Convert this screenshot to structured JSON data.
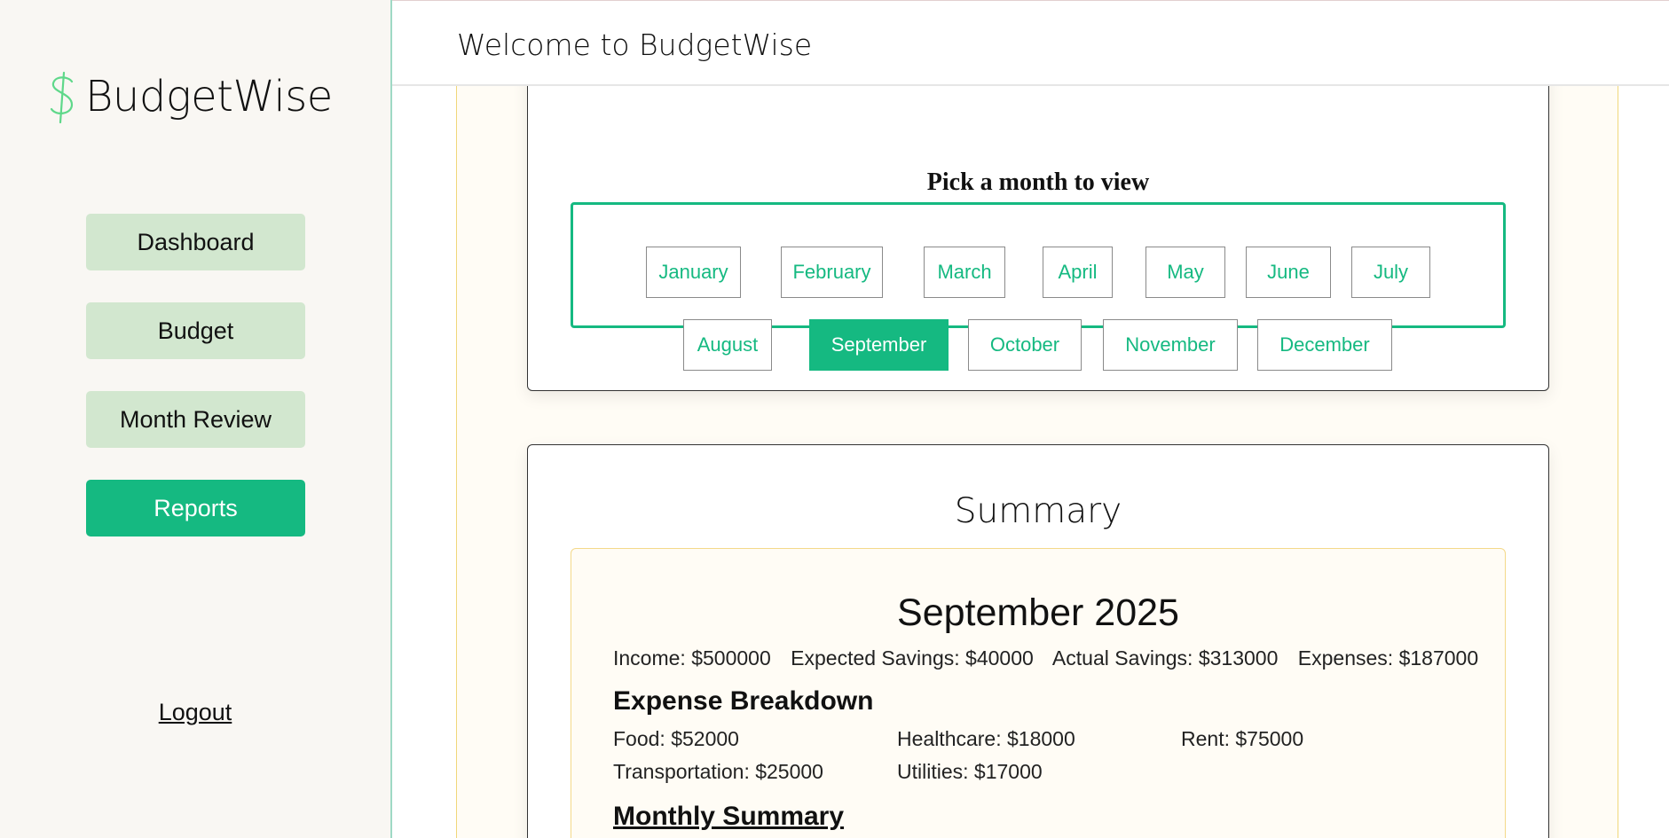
{
  "app": {
    "logo_text": "BudgetWise",
    "logo_icon": "dollar-sign-icon",
    "header_title": "Welcome to BudgetWise"
  },
  "sidebar": {
    "items": [
      {
        "label": "Dashboard",
        "active": false
      },
      {
        "label": "Budget",
        "active": false
      },
      {
        "label": "Month Review",
        "active": false
      },
      {
        "label": "Reports",
        "active": true
      }
    ],
    "logout_label": "Logout"
  },
  "month_picker": {
    "title": "Pick a month to view",
    "months": [
      "January",
      "February",
      "March",
      "April",
      "May",
      "June",
      "July",
      "August",
      "September",
      "October",
      "November",
      "December"
    ],
    "selected": "September"
  },
  "summary": {
    "title": "Summary",
    "period": "September 2025",
    "stats": {
      "income": "Income: $500000",
      "expected_savings": "Expected Savings: $40000",
      "actual_savings": "Actual Savings: $313000",
      "expenses": "Expenses: $187000"
    },
    "breakdown_title": "Expense Breakdown",
    "breakdown": {
      "food": "Food: $52000",
      "healthcare": "Healthcare: $18000",
      "rent": "Rent: $75000",
      "transportation": "Transportation: $25000",
      "utilities": "Utilities: $17000"
    },
    "monthly_summary_title": "Monthly Summary"
  },
  "colors": {
    "accent": "#15b981",
    "nav_inactive": "#d2e7cf",
    "sidebar_bg": "#f9f7f3",
    "content_bg": "#fffcf5",
    "gold_border": "#f0d77a"
  }
}
